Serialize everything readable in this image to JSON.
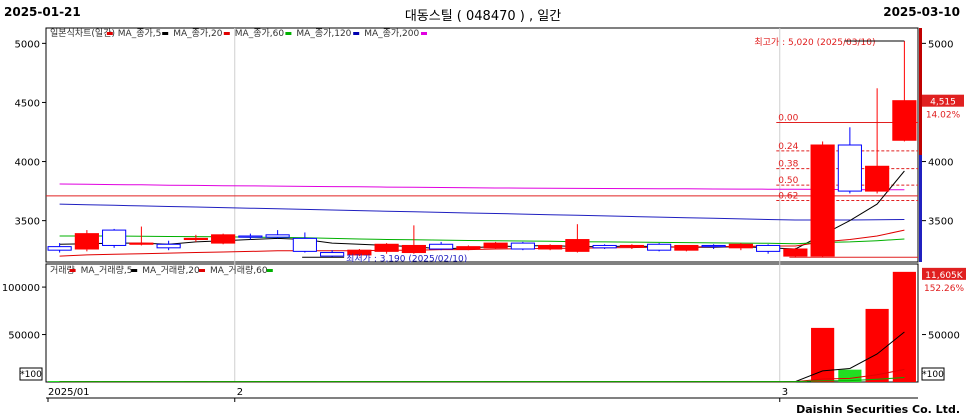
{
  "header": {
    "start_date": "2025-01-21",
    "title": "대동스틸 ( 048470 ) , 일간",
    "end_date": "2025-03-10"
  },
  "footer": "Daishin Securities Co. Ltd.",
  "price_legend": [
    {
      "label": "일본식차트(일간)",
      "color": "#e00000"
    },
    {
      "label": "MA_종가,5",
      "color": "#000000"
    },
    {
      "label": "MA_종가,20",
      "color": "#e00000"
    },
    {
      "label": "MA_종가,60",
      "color": "#00b000"
    },
    {
      "label": "MA_종가,120",
      "color": "#0000b0"
    },
    {
      "label": "MA_종가,200",
      "color": "#e000e0"
    }
  ],
  "volume_legend": [
    {
      "label": "거래량",
      "color": "#e00000"
    },
    {
      "label": "MA_거래량,5",
      "color": "#000000"
    },
    {
      "label": "MA_거래량,20",
      "color": "#e00000"
    },
    {
      "label": "MA_거래량,60",
      "color": "#00b000"
    }
  ],
  "annotations": {
    "high": "최고가 : 5,020 (2025/03/10)",
    "low": "최저가 : 3,190 (2025/02/10)",
    "last_price": "4,515",
    "last_change": "14.02%",
    "last_volume": "11,605K",
    "volume_change": "152.26%",
    "volume_unit": "*100"
  },
  "fib_levels": [
    {
      "label": "0.00",
      "value": 4330
    },
    {
      "label": "0.24",
      "value": 4090
    },
    {
      "label": "0.38",
      "value": 3940
    },
    {
      "label": "0.50",
      "value": 3800
    },
    {
      "label": "0.62",
      "value": 3670
    }
  ],
  "x_ticks": [
    {
      "label": "2025/01",
      "index": 0
    },
    {
      "label": "2",
      "index": 7
    },
    {
      "label": "3",
      "index": 27
    }
  ],
  "chart_data": {
    "type": "candlestick",
    "price_axis": {
      "ticks": [
        3500,
        4000,
        4500,
        5000
      ],
      "range": [
        3150,
        5130
      ]
    },
    "volume_axis": {
      "ticks": [
        50000,
        100000
      ],
      "range": [
        0,
        118000
      ]
    },
    "candles": [
      {
        "o": 3280,
        "h": 3310,
        "l": 3230,
        "c": 3250
      },
      {
        "o": 3260,
        "h": 3420,
        "l": 3240,
        "c": 3390
      },
      {
        "o": 3420,
        "h": 3430,
        "l": 3270,
        "c": 3290
      },
      {
        "o": 3300,
        "h": 3450,
        "l": 3290,
        "c": 3310
      },
      {
        "o": 3300,
        "h": 3330,
        "l": 3250,
        "c": 3270
      },
      {
        "o": 3340,
        "h": 3380,
        "l": 3320,
        "c": 3350
      },
      {
        "o": 3310,
        "h": 3390,
        "l": 3300,
        "c": 3380
      },
      {
        "o": 3370,
        "h": 3390,
        "l": 3340,
        "c": 3360
      },
      {
        "o": 3380,
        "h": 3420,
        "l": 3350,
        "c": 3360
      },
      {
        "o": 3350,
        "h": 3400,
        "l": 3230,
        "c": 3240
      },
      {
        "o": 3230,
        "h": 3250,
        "l": 3190,
        "c": 3200
      },
      {
        "o": 3210,
        "h": 3260,
        "l": 3200,
        "c": 3250
      },
      {
        "o": 3240,
        "h": 3310,
        "l": 3220,
        "c": 3300
      },
      {
        "o": 3230,
        "h": 3460,
        "l": 3220,
        "c": 3290
      },
      {
        "o": 3300,
        "h": 3320,
        "l": 3250,
        "c": 3260
      },
      {
        "o": 3260,
        "h": 3290,
        "l": 3250,
        "c": 3280
      },
      {
        "o": 3270,
        "h": 3320,
        "l": 3260,
        "c": 3310
      },
      {
        "o": 3310,
        "h": 3320,
        "l": 3250,
        "c": 3260
      },
      {
        "o": 3260,
        "h": 3300,
        "l": 3250,
        "c": 3290
      },
      {
        "o": 3240,
        "h": 3470,
        "l": 3230,
        "c": 3340
      },
      {
        "o": 3290,
        "h": 3300,
        "l": 3260,
        "c": 3270
      },
      {
        "o": 3280,
        "h": 3300,
        "l": 3260,
        "c": 3290
      },
      {
        "o": 3300,
        "h": 3310,
        "l": 3240,
        "c": 3250
      },
      {
        "o": 3250,
        "h": 3290,
        "l": 3240,
        "c": 3290
      },
      {
        "o": 3290,
        "h": 3300,
        "l": 3260,
        "c": 3280
      },
      {
        "o": 3270,
        "h": 3310,
        "l": 3250,
        "c": 3300
      },
      {
        "o": 3290,
        "h": 3300,
        "l": 3220,
        "c": 3240
      },
      {
        "o": 3200,
        "h": 3270,
        "l": 3190,
        "c": 3260
      },
      {
        "o": 3200,
        "h": 4170,
        "l": 3190,
        "c": 4140
      },
      {
        "o": 4140,
        "h": 4290,
        "l": 3730,
        "c": 3750
      },
      {
        "o": 3750,
        "h": 4620,
        "l": 3730,
        "c": 3960
      },
      {
        "o": 4180,
        "h": 5020,
        "l": 4170,
        "c": 4515
      }
    ],
    "volume": [
      300,
      400,
      350,
      300,
      300,
      280,
      350,
      300,
      300,
      400,
      500,
      400,
      350,
      500,
      300,
      350,
      400,
      300,
      350,
      600,
      350,
      300,
      300,
      350,
      300,
      300,
      400,
      500,
      57000,
      13000,
      77000,
      116050
    ],
    "ma_price": [
      {
        "name": "MA_종가,5",
        "color": "#000000",
        "values": [
          3300,
          3305,
          3310,
          3310,
          3300,
          3320,
          3330,
          3340,
          3350,
          3340,
          3310,
          3300,
          3290,
          3280,
          3260,
          3270,
          3280,
          3285,
          3290,
          3280,
          3280,
          3285,
          3280,
          3275,
          3275,
          3280,
          3270,
          3260,
          3380,
          3500,
          3640,
          3920
        ]
      },
      {
        "name": "MA_종가,20",
        "color": "#e00000",
        "values": [
          3200,
          3210,
          3215,
          3220,
          3225,
          3230,
          3235,
          3240,
          3245,
          3245,
          3245,
          3245,
          3250,
          3250,
          3255,
          3255,
          3260,
          3262,
          3265,
          3267,
          3270,
          3272,
          3275,
          3277,
          3280,
          3282,
          3285,
          3285,
          3320,
          3340,
          3370,
          3420
        ]
      },
      {
        "name": "MA_종가,60",
        "color": "#00b000",
        "values": [
          3370,
          3370,
          3370,
          3368,
          3366,
          3365,
          3363,
          3360,
          3358,
          3355,
          3350,
          3345,
          3340,
          3338,
          3335,
          3332,
          3330,
          3328,
          3325,
          3322,
          3320,
          3318,
          3316,
          3314,
          3312,
          3310,
          3308,
          3305,
          3315,
          3320,
          3330,
          3345
        ]
      },
      {
        "name": "MA_종가,120",
        "color": "#2020c0",
        "values": [
          3640,
          3635,
          3630,
          3625,
          3620,
          3615,
          3610,
          3605,
          3600,
          3595,
          3590,
          3585,
          3580,
          3575,
          3570,
          3565,
          3560,
          3555,
          3550,
          3545,
          3540,
          3535,
          3530,
          3525,
          3520,
          3515,
          3510,
          3505,
          3505,
          3505,
          3508,
          3510
        ]
      },
      {
        "name": "MA_종가,200",
        "color": "#e000e0",
        "values": [
          3810,
          3808,
          3805,
          3803,
          3800,
          3798,
          3796,
          3794,
          3792,
          3790,
          3788,
          3786,
          3784,
          3782,
          3780,
          3778,
          3776,
          3775,
          3774,
          3773,
          3772,
          3771,
          3770,
          3769,
          3768,
          3767,
          3766,
          3765,
          3764,
          3763,
          3762,
          3762
        ]
      }
    ],
    "ma_volume": [
      {
        "name": "MA_거래량,5",
        "color": "#000000",
        "values": [
          350,
          350,
          350,
          350,
          350,
          340,
          330,
          320,
          310,
          330,
          360,
          380,
          390,
          430,
          410,
          380,
          380,
          360,
          340,
          400,
          390,
          380,
          360,
          380,
          340,
          320,
          330,
          370,
          11700,
          14200,
          29500,
          52700
        ]
      },
      {
        "name": "MA_거래량,20",
        "color": "#e00000",
        "values": [
          380,
          380,
          380,
          380,
          380,
          380,
          380,
          380,
          380,
          380,
          380,
          380,
          380,
          380,
          380,
          380,
          380,
          380,
          380,
          380,
          380,
          380,
          380,
          380,
          380,
          380,
          380,
          380,
          3200,
          3800,
          7600,
          13300
        ]
      },
      {
        "name": "MA_거래량,60",
        "color": "#00b000",
        "values": [
          400,
          400,
          400,
          400,
          400,
          400,
          400,
          400,
          400,
          400,
          400,
          400,
          400,
          400,
          400,
          400,
          400,
          400,
          400,
          400,
          400,
          400,
          400,
          400,
          400,
          400,
          400,
          400,
          1300,
          1500,
          2800,
          4700
        ]
      }
    ]
  }
}
